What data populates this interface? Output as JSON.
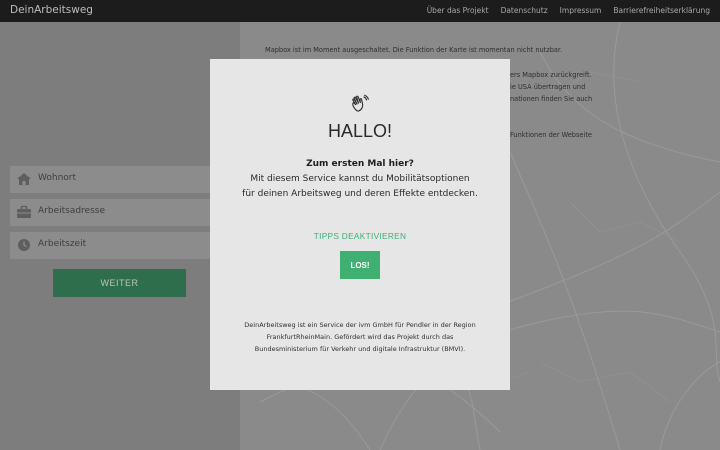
{
  "header": {
    "brand": "DeinArbeitsweg",
    "nav": [
      "Über das Projekt",
      "Datenschutz",
      "Impressum",
      "Barrierefreiheitserklärung"
    ]
  },
  "form": {
    "fields": [
      {
        "icon": "home-icon",
        "label": "Wohnort"
      },
      {
        "icon": "briefcase-icon",
        "label": "Arbeitsadresse"
      },
      {
        "icon": "clock-icon",
        "label": "Arbeitszeit"
      }
    ],
    "submit_label": "WEITER"
  },
  "map": {
    "notice_lines": [
      "Mapbox ist im Moment ausgeschaltet. Die Funktion der Karte ist momentan nicht nutzbar.",
      "ers Mapbox zurückgreift.",
      "ie USA übertragen und",
      "nationen finden Sie auch",
      "Funktionen der Webseite"
    ]
  },
  "modal": {
    "icon": "waving-hand-icon",
    "title": "HALLO!",
    "subhead": "Zum ersten Mal hier?",
    "desc_line1": "Mit diesem Service kannst du Mobilitätsoptionen",
    "desc_line2": "für deinen Arbeitsweg und deren Effekte entdecken.",
    "tips_label": "TIPPS DEAKTIVIEREN",
    "los_label": "LOS!",
    "footer_line1": "DeinArbeitsweg ist ein Service der ivm GmbH für Pendler in der Region",
    "footer_line2": "FrankfurtRheinMain. Gefördert wird das Projekt durch das",
    "footer_line3": "Bundesministerium für Verkehr und digitale Infrastruktur (BMVI)."
  },
  "colors": {
    "accent_green": "#3fb072",
    "dark_green": "#2f6e4c",
    "topbar": "#1c1c1c"
  }
}
